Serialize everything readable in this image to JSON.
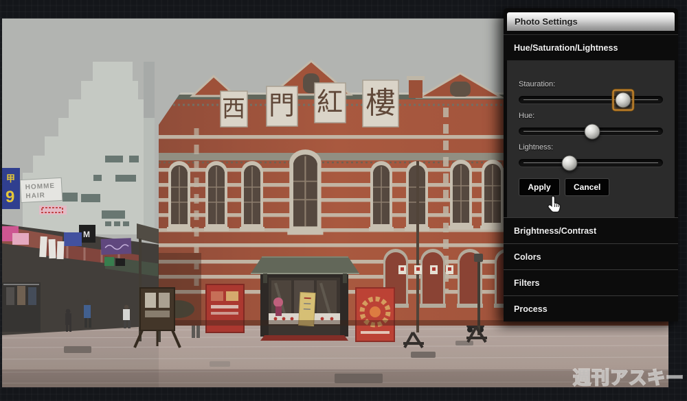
{
  "photo_editor": {
    "panel": {
      "title": "Photo Settings",
      "active_section": {
        "label": "Hue/Saturation/Lightness"
      },
      "sliders": [
        {
          "id": "saturation",
          "label": "Stauration:",
          "percent": 72.5,
          "focused": true
        },
        {
          "id": "hue",
          "label": "Hue:",
          "percent": 51,
          "focused": false
        },
        {
          "id": "lightness",
          "label": "Lightness:",
          "percent": 35,
          "focused": false
        }
      ],
      "buttons": {
        "apply": "Apply",
        "cancel": "Cancel"
      },
      "collapsed_sections": [
        {
          "label": "Brightness/Contrast"
        },
        {
          "label": "Colors"
        },
        {
          "label": "Filters"
        },
        {
          "label": "Process"
        }
      ],
      "colors": {
        "focus_ring": "#c8862c",
        "header_gradient_top": "#ffffff",
        "header_gradient_bottom": "#8b8b8b",
        "section_bg": "#0c0c0c",
        "slider_box_bg": "#2b2b2b"
      }
    },
    "photo_content": {
      "building_plaque_chars": [
        "西",
        "門",
        "紅",
        "樓"
      ],
      "homme_sign_lines": [
        "HOMME",
        "HAIR"
      ],
      "left_blue_sign_chars": [
        "甲",
        "9"
      ],
      "black_sign_char": "M",
      "watermark_text": "週刊アスキー"
    }
  }
}
